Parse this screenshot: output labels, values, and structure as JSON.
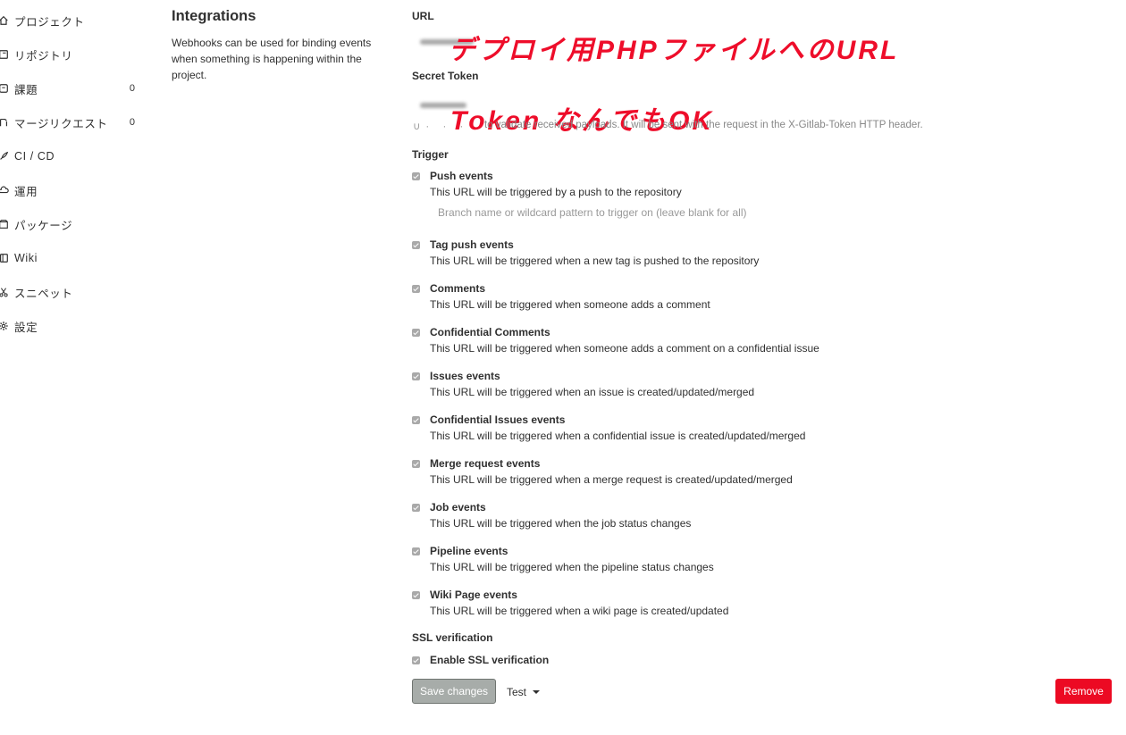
{
  "sidebar": {
    "items": [
      {
        "icon": "home-icon",
        "label": "プロジェクト",
        "count": ""
      },
      {
        "icon": "repository-icon",
        "label": "リポジトリ",
        "count": ""
      },
      {
        "icon": "issues-icon",
        "label": "課題",
        "count": "0"
      },
      {
        "icon": "merge-request-icon",
        "label": "マージリクエスト",
        "count": "0"
      },
      {
        "icon": "rocket-icon",
        "label": "CI / CD",
        "count": ""
      },
      {
        "icon": "cloud-icon",
        "label": "運用",
        "count": ""
      },
      {
        "icon": "package-icon",
        "label": "パッケージ",
        "count": ""
      },
      {
        "icon": "book-icon",
        "label": "Wiki",
        "count": ""
      },
      {
        "icon": "scissors-icon",
        "label": "スニペット",
        "count": ""
      },
      {
        "icon": "gear-icon",
        "label": "設定",
        "count": ""
      }
    ]
  },
  "integrations": {
    "title": "Integrations",
    "description": "Webhooks can be used for binding events when something is happening within the project."
  },
  "form": {
    "url_label": "URL",
    "secret_token_label": "Secret Token",
    "token_help": "to validate received payloads. It will be sent with the request in the X-Gitlab-Token HTTP header.",
    "trigger_label": "Trigger",
    "branch_placeholder": "Branch name or wildcard pattern to trigger on (leave blank for all)",
    "triggers": [
      {
        "title": "Push events",
        "desc": "This URL will be triggered by a push to the repository",
        "checked": true
      },
      {
        "title": "Tag push events",
        "desc": "This URL will be triggered when a new tag is pushed to the repository",
        "checked": true
      },
      {
        "title": "Comments",
        "desc": "This URL will be triggered when someone adds a comment",
        "checked": true
      },
      {
        "title": "Confidential Comments",
        "desc": "This URL will be triggered when someone adds a comment on a confidential issue",
        "checked": true
      },
      {
        "title": "Issues events",
        "desc": "This URL will be triggered when an issue is created/updated/merged",
        "checked": true
      },
      {
        "title": "Confidential Issues events",
        "desc": "This URL will be triggered when a confidential issue is created/updated/merged",
        "checked": true
      },
      {
        "title": "Merge request events",
        "desc": "This URL will be triggered when a merge request is created/updated/merged",
        "checked": true
      },
      {
        "title": "Job events",
        "desc": "This URL will be triggered when the job status changes",
        "checked": true
      },
      {
        "title": "Pipeline events",
        "desc": "This URL will be triggered when the pipeline status changes",
        "checked": true
      },
      {
        "title": "Wiki Page events",
        "desc": "This URL will be triggered when a wiki page is created/updated",
        "checked": true
      }
    ],
    "ssl_label": "SSL verification",
    "ssl_checkbox": "Enable SSL verification"
  },
  "annotations": {
    "url_note": "デプロイ用PHPファイルへのURL",
    "token_note": "Token なんでもOK"
  },
  "actions": {
    "save": "Save changes",
    "test": "Test",
    "remove": "Remove"
  },
  "colors": {
    "remove_button": "#ec0a23",
    "annotation_red": "#ee0d2a",
    "save_button": "#a7aca9"
  }
}
